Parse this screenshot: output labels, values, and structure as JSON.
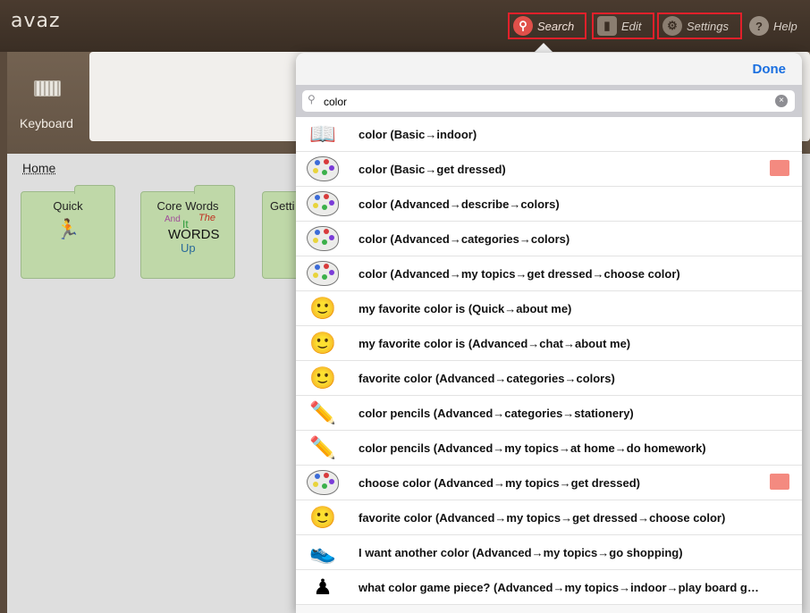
{
  "app": {
    "title": "avaz"
  },
  "toolbar": {
    "search": "Search",
    "edit": "Edit",
    "settings": "Settings",
    "help": "Help",
    "help_glyph": "?"
  },
  "keyboard": {
    "label": "Keyboard"
  },
  "home": {
    "label": "Home",
    "folders": [
      {
        "label": "Quick"
      },
      {
        "label": "Core Words",
        "word_and": "And",
        "word_it": "It",
        "word_the": "The",
        "word_words": "WORDS",
        "word_up": "Up"
      },
      {
        "label": "Getti"
      }
    ]
  },
  "popover": {
    "done": "Done",
    "search": {
      "value": "color",
      "placeholder": ""
    },
    "results": [
      {
        "text": "color (Basic→indoor)",
        "icon": "book-icon",
        "folder": false
      },
      {
        "text": "color (Basic→get dressed)",
        "icon": "palette-icon",
        "folder": true
      },
      {
        "text": "color (Advanced→describe→colors)",
        "icon": "palette-icon",
        "folder": false
      },
      {
        "text": "color (Advanced→categories→colors)",
        "icon": "palette-icon",
        "folder": false
      },
      {
        "text": "color (Advanced→my topics→get dressed→choose color)",
        "icon": "palette-icon",
        "folder": false
      },
      {
        "text": "my favorite color is (Quick→about me)",
        "icon": "person-icon",
        "folder": false
      },
      {
        "text": "my favorite color is (Advanced→chat→about me)",
        "icon": "person-icon",
        "folder": false
      },
      {
        "text": "favorite color (Advanced→categories→colors)",
        "icon": "person-icon",
        "folder": false
      },
      {
        "text": "color pencils (Advanced→categories→stationery)",
        "icon": "pencils-icon",
        "folder": false
      },
      {
        "text": "color pencils (Advanced→my topics→at home→do homework)",
        "icon": "pencils-icon",
        "folder": false
      },
      {
        "text": "choose color (Advanced→my topics→get dressed)",
        "icon": "palette-icon",
        "folder": true
      },
      {
        "text": "favorite color (Advanced→my topics→get dressed→choose color)",
        "icon": "person-icon",
        "folder": false
      },
      {
        "text": "I want another color (Advanced→my topics→go shopping)",
        "icon": "shoes-icon",
        "folder": false
      },
      {
        "text": "what color game piece? (Advanced→my topics→indoor→play board g…",
        "icon": "game-pieces-icon",
        "folder": false
      }
    ]
  },
  "colors": {
    "highlight_box": "#e2202a",
    "folder_green": "#bfd8a8",
    "done_blue": "#1a6fe0",
    "folder_pink": "#f48a80"
  }
}
